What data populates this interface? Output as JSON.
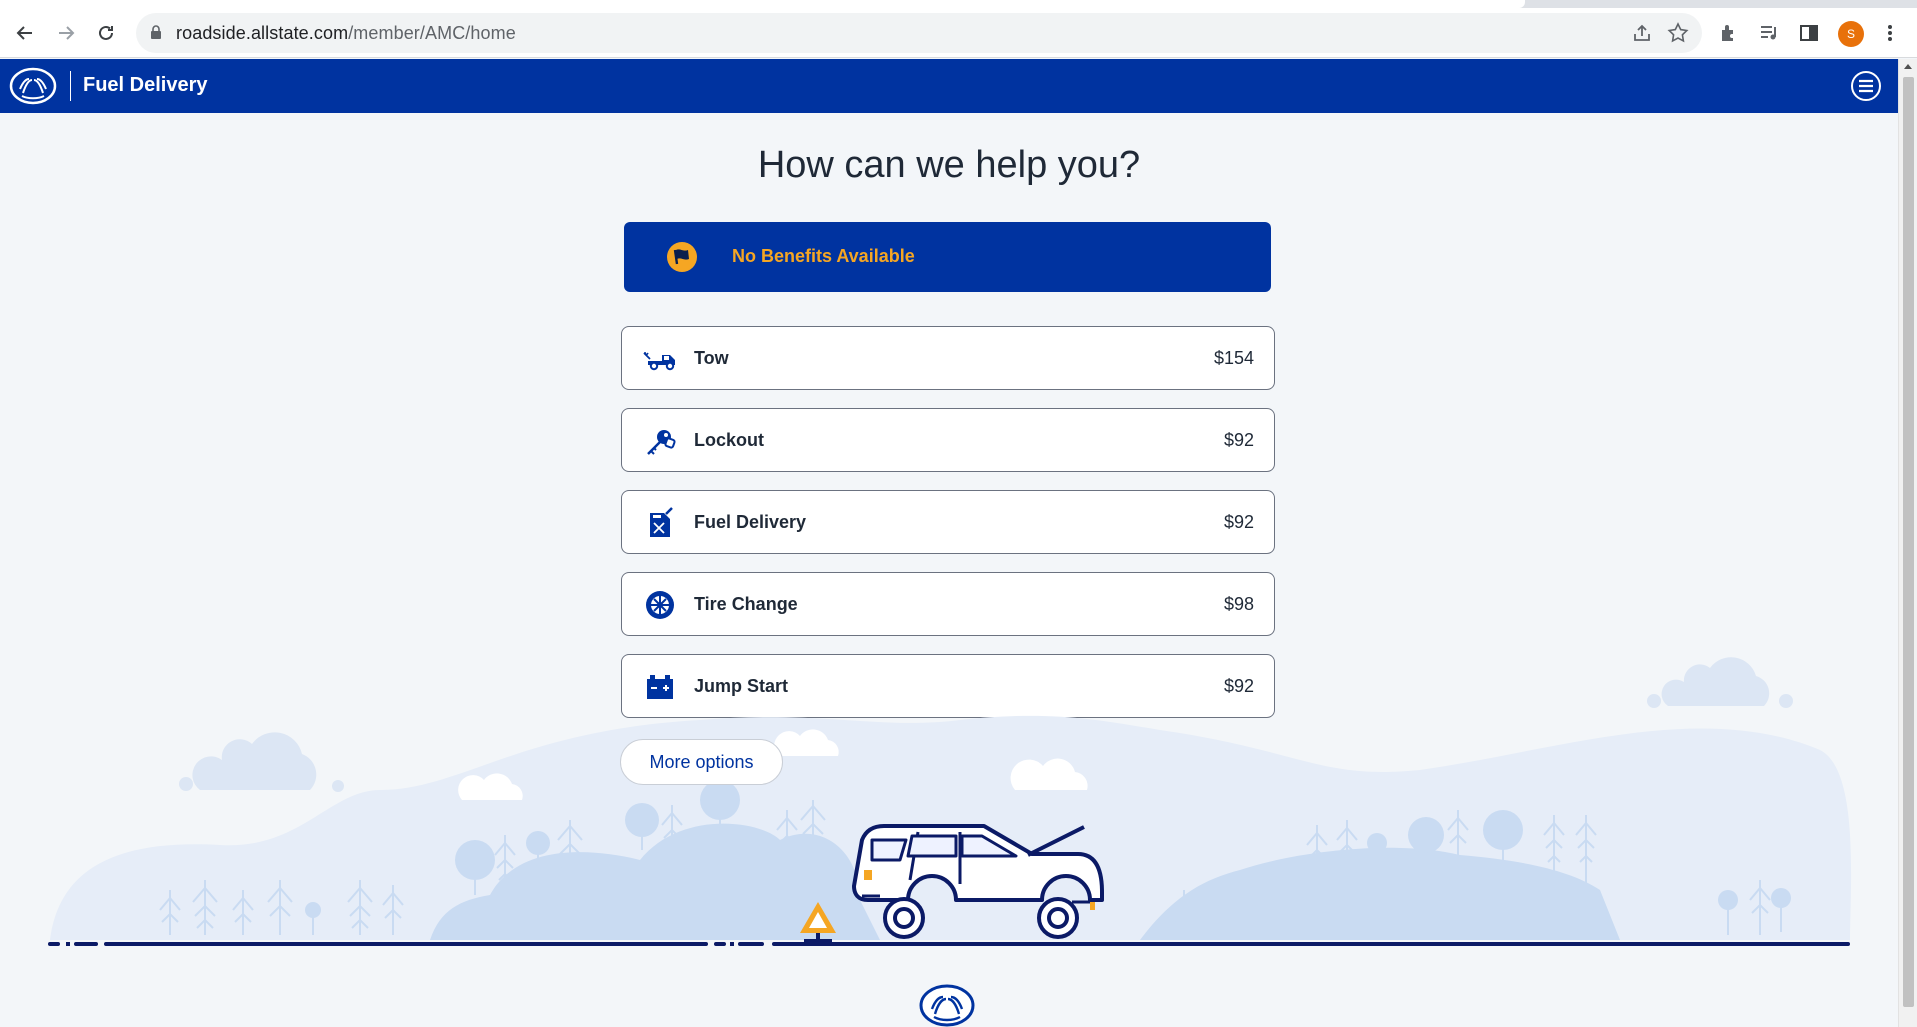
{
  "browser": {
    "url_domain": "roadside.allstate.com",
    "url_path": "/member/AMC/home",
    "profile_initial": "S"
  },
  "header": {
    "title": "Fuel Delivery"
  },
  "main": {
    "heading": "How can we help you?",
    "banner": "No Benefits Available",
    "services": [
      {
        "label": "Tow",
        "price": "$154",
        "icon": "tow-truck-icon"
      },
      {
        "label": "Lockout",
        "price": "$92",
        "icon": "key-icon"
      },
      {
        "label": "Fuel Delivery",
        "price": "$92",
        "icon": "fuel-can-icon"
      },
      {
        "label": "Tire Change",
        "price": "$98",
        "icon": "tire-icon"
      },
      {
        "label": "Jump Start",
        "price": "$92",
        "icon": "battery-icon"
      }
    ],
    "more_options": "More options"
  },
  "colors": {
    "brand_blue": "#0033a0",
    "banner_text": "#f5a623",
    "warning_orange": "#f5a623"
  }
}
